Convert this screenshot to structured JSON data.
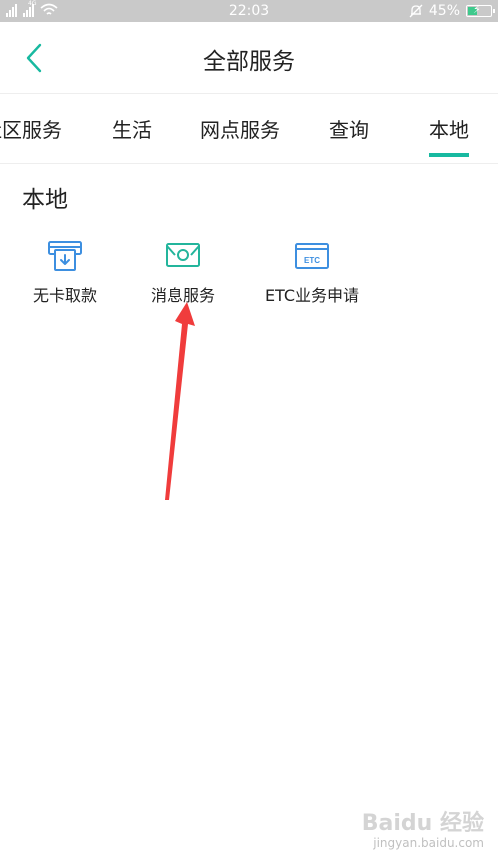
{
  "status_bar": {
    "net_label": "4G",
    "time": "22:03",
    "battery_percent": "45%",
    "battery_level": 0.45
  },
  "header": {
    "title": "全部服务"
  },
  "tabs": [
    {
      "label": "社区服务",
      "active": false
    },
    {
      "label": "生活",
      "active": false
    },
    {
      "label": "网点服务",
      "active": false
    },
    {
      "label": "查询",
      "active": false
    },
    {
      "label": "本地",
      "active": true
    }
  ],
  "section": {
    "title": "本地",
    "items": [
      {
        "label": "无卡取款",
        "icon": "atm-withdraw-icon"
      },
      {
        "label": "消息服务",
        "icon": "message-envelope-icon"
      },
      {
        "label": "ETC业务申请",
        "icon": "etc-card-icon",
        "icon_text": "ETC"
      }
    ]
  },
  "annotation": {
    "arrow_color": "#f03c3c"
  },
  "colors": {
    "accent": "#18b9a0",
    "icon_blue": "#3d8fe0",
    "icon_green": "#23b59c"
  },
  "watermark": {
    "brand": "Baidu 经验",
    "url": "jingyan.baidu.com"
  }
}
